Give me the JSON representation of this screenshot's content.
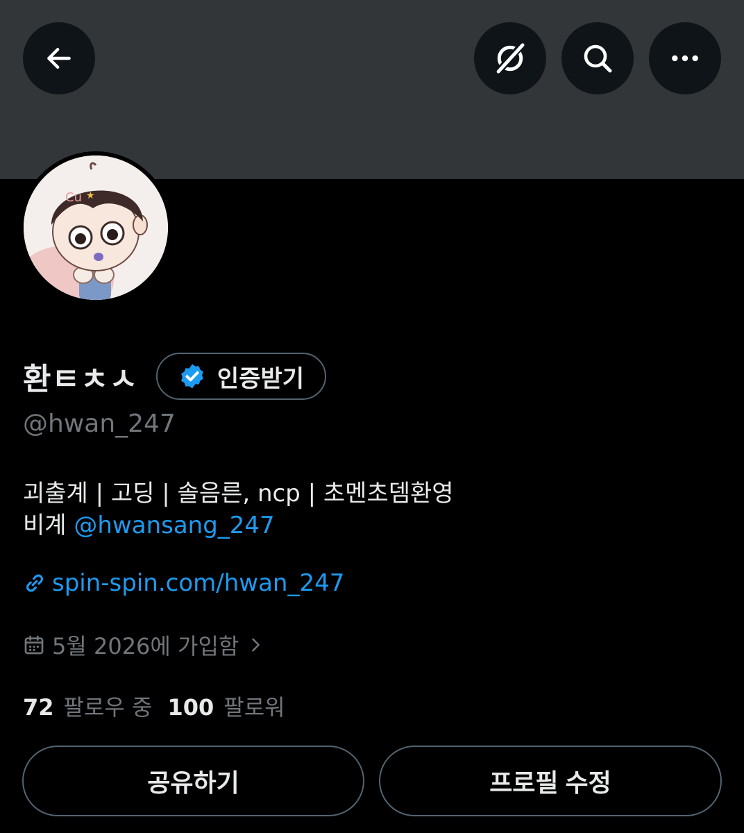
{
  "header": {
    "back_icon": "arrow-left-icon",
    "grok_icon": "grok-icon",
    "search_icon": "search-icon",
    "more_icon": "more-dots-icon"
  },
  "profile": {
    "display_name": "환ㅌㅊㅅ",
    "verify_label": "인증받기",
    "handle": "@hwan_247",
    "bio_line1": "괴출계 | 고딩 | 솔음른, ncp | 초멘초뎀환영",
    "bio_line2_prefix": "비계 ",
    "bio_mention": "@hwansang_247",
    "website": "spin-spin.com/hwan_247",
    "joined": "5월 2026에 가입함",
    "following_count": "72",
    "following_label": "팔로우 중",
    "followers_count": "100",
    "followers_label": "팔로워"
  },
  "actions": {
    "share_label": "공유하기",
    "edit_label": "프로필 수정"
  },
  "colors": {
    "accent": "#1d9bf0",
    "background": "#000000",
    "banner": "#333639",
    "muted": "#71767b",
    "border": "#536471"
  }
}
